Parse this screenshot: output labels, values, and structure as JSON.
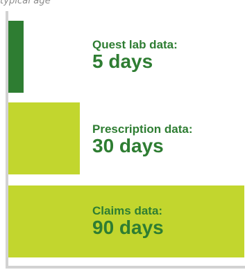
{
  "caption": "typical age",
  "colors": {
    "dark_bar": "#2e7d32",
    "light_bar": "#c2d62e",
    "label_text": "#2e7d32",
    "axis": "#d2d2d2"
  },
  "chart_data": {
    "type": "bar",
    "orientation": "horizontal",
    "categories": [
      "Quest lab data",
      "Prescription data",
      "Claims data"
    ],
    "values": [
      5,
      30,
      90
    ],
    "unit": "days",
    "bars": [
      {
        "name": "Quest lab data:",
        "value_text": "5 days",
        "value": 5,
        "color": "#2e7d32"
      },
      {
        "name": "Prescription data:",
        "value_text": "30 days",
        "value": 30,
        "color": "#c2d62e"
      },
      {
        "name": "Claims data:",
        "value_text": "90 days",
        "value": 90,
        "color": "#c2d62e"
      }
    ],
    "xlim": [
      0,
      90
    ]
  }
}
